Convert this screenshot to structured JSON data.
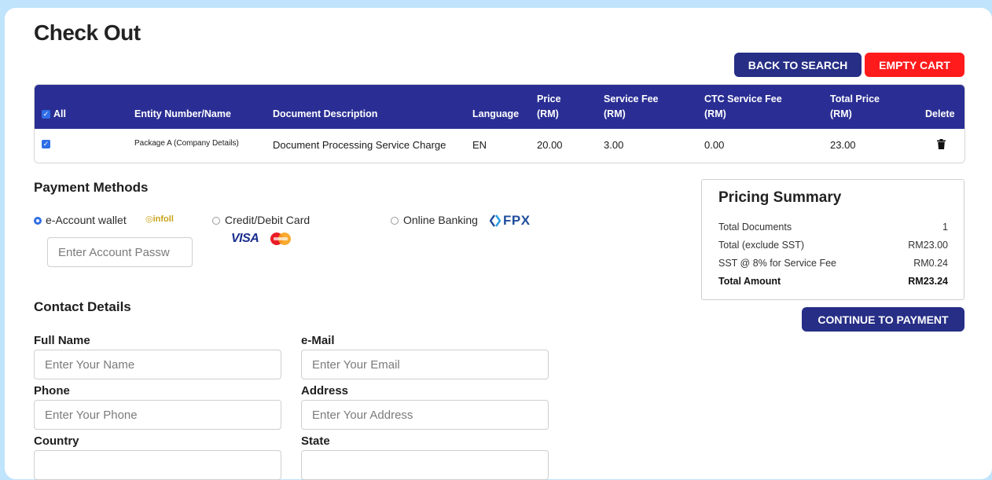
{
  "page": {
    "title": "Check Out"
  },
  "actions": {
    "back_to_search": "BACK TO SEARCH",
    "empty_cart": "EMPTY CART",
    "continue_to_payment": "CONTINUE TO PAYMENT"
  },
  "cart": {
    "headers": {
      "all": "All",
      "entity": "Entity Number/Name",
      "description": "Document Description",
      "language": "Language",
      "price_l1": "Price",
      "price_l2": "(RM)",
      "service_fee_l1": "Service Fee",
      "service_fee_l2": "(RM)",
      "ctc_fee_l1": "CTC Service Fee",
      "ctc_fee_l2": "(RM)",
      "total_l1": "Total Price",
      "total_l2": "(RM)",
      "delete": "Delete"
    },
    "rows": [
      {
        "entity": "Package A (Company Details)",
        "description": "Document Processing Service Charge",
        "language": "EN",
        "price": "20.00",
        "service_fee": "3.00",
        "ctc_fee": "0.00",
        "total": "23.00",
        "checked": true
      }
    ]
  },
  "payment": {
    "title": "Payment Methods",
    "methods": [
      {
        "label": "e-Account wallet",
        "logo_text": "infoll",
        "selected": true
      },
      {
        "label": "Credit/Debit Card",
        "logo_text": "VISA",
        "selected": false
      },
      {
        "label": "Online Banking",
        "logo_text": "FPX",
        "selected": false
      }
    ],
    "password_placeholder": "Enter Account Passw"
  },
  "contact": {
    "title": "Contact Details",
    "full_name": {
      "label": "Full Name",
      "placeholder": "Enter Your Name"
    },
    "email": {
      "label": "e-Mail",
      "placeholder": "Enter Your Email"
    },
    "phone": {
      "label": "Phone",
      "placeholder": "Enter Your Phone"
    },
    "address": {
      "label": "Address",
      "placeholder": "Enter Your Address"
    },
    "country": {
      "label": "Country"
    },
    "state": {
      "label": "State"
    }
  },
  "summary": {
    "title": "Pricing Summary",
    "rows": [
      {
        "label": "Total Documents",
        "value": "1"
      },
      {
        "label": "Total (exclude SST)",
        "value": "RM23.00"
      },
      {
        "label": "SST @ 8% for Service Fee",
        "value": "RM0.24"
      },
      {
        "label": "Total Amount",
        "value": "RM23.24"
      }
    ]
  },
  "colors": {
    "header_bg": "#2a2e94",
    "primary_button": "#262e86",
    "danger_button": "#ff1b1b",
    "page_bg": "#bfe4fb",
    "checkbox": "#2f6ee6"
  },
  "icons": {
    "delete": "trash-icon",
    "checkbox": "checkmark-icon",
    "card_brand": "mastercard-icon",
    "fpx": "fpx-icon"
  }
}
